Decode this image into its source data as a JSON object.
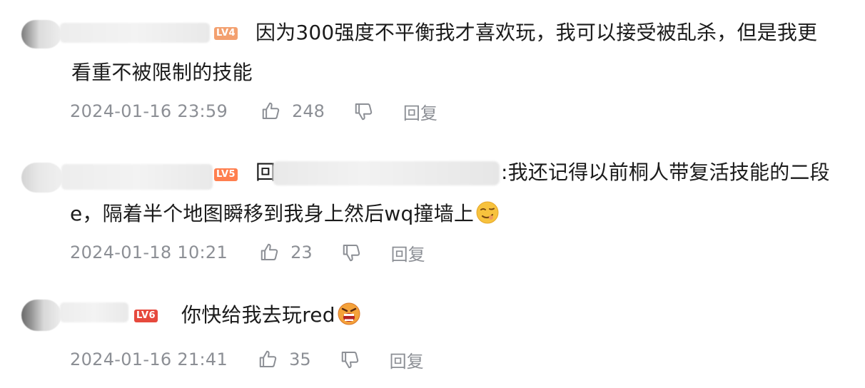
{
  "comments": [
    {
      "level": "LV4",
      "level_color": "#f3a06f",
      "text_line1": "因为300强度不平衡我才喜欢玩，我可以接受被乱杀，但是我更",
      "text_line2": "看重不被限制的技能",
      "date": "2024-01-16 23:59",
      "likes": "248",
      "reply_label": "回复"
    },
    {
      "level": "LV5",
      "level_color": "#ff7f4f",
      "text_prefix": "回",
      "text_line1": ":我还记得以前桐人带复活技能的二段",
      "text_line2": "e，隔着半个地图瞬移到我身上然后wq撞墙上",
      "date": "2024-01-18 10:21",
      "likes": "23",
      "reply_label": "回复",
      "emoji": "smirk-face"
    },
    {
      "level": "LV6",
      "level_color": "#e6493d",
      "text_line1": "你快给我去玩red",
      "date": "2024-01-16 21:41",
      "likes": "35",
      "reply_label": "回复",
      "emoji": "angry-face"
    }
  ],
  "icons": {
    "like": "thumbs-up-icon",
    "dislike": "thumbs-down-icon"
  }
}
